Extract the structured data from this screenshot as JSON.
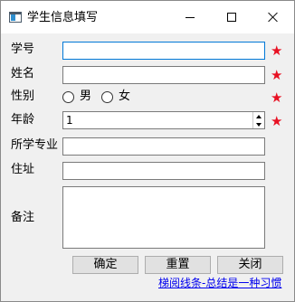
{
  "window": {
    "title": "学生信息填写",
    "icons": {
      "app": "form-window-icon",
      "minimize": "minimize-icon",
      "maximize": "maximize-icon",
      "close": "close-icon"
    }
  },
  "form": {
    "student_id": {
      "label": "学号",
      "value": "",
      "required_mark": "★"
    },
    "name": {
      "label": "姓名",
      "value": "",
      "required_mark": "★"
    },
    "gender": {
      "label": "性别",
      "options": [
        "男",
        "女"
      ],
      "selected": null,
      "required_mark": "★"
    },
    "age": {
      "label": "年龄",
      "value": "1",
      "required_mark": "★"
    },
    "major": {
      "label": "所学专业",
      "value": ""
    },
    "address": {
      "label": "住址",
      "value": ""
    },
    "remarks": {
      "label": "备注",
      "value": ""
    }
  },
  "buttons": {
    "ok": "确定",
    "reset": "重置",
    "close": "关闭"
  },
  "footer": {
    "link_text": "梯阅线条-总结是一种习惯"
  },
  "colors": {
    "required_star": "#e81123",
    "focus_border": "#0078d7",
    "link": "#0000ee"
  }
}
